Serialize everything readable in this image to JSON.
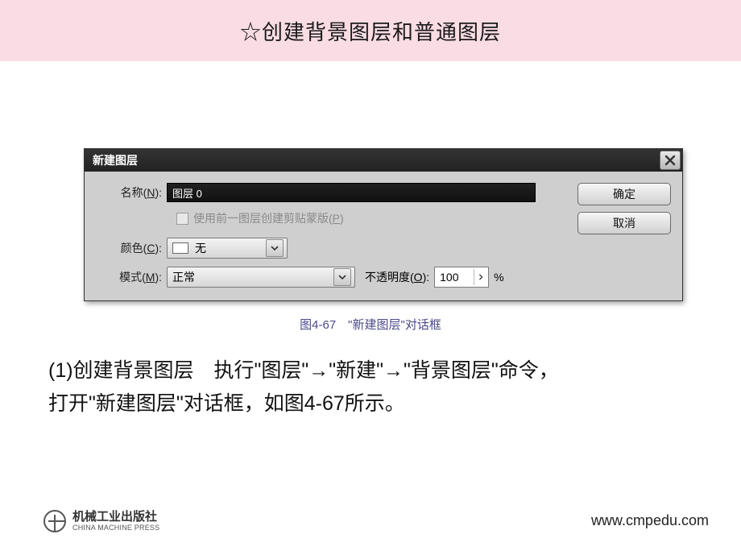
{
  "header": {
    "title": "☆创建背景图层和普通图层"
  },
  "dialog": {
    "title": "新建图层",
    "name_label_pre": "名称(",
    "name_hotkey": "N",
    "name_label_post": "):",
    "name_value": "图层 0",
    "clip_checkbox_label_pre": "使用前一图层创建剪贴蒙版(",
    "clip_hotkey": "P",
    "clip_checkbox_label_post": ")",
    "color_label_pre": "颜色(",
    "color_hotkey": "C",
    "color_label_post": "):",
    "color_value": "无",
    "mode_label_pre": "模式(",
    "mode_hotkey": "M",
    "mode_label_post": "):",
    "mode_value": "正常",
    "opacity_label_pre": "不透明度(",
    "opacity_hotkey": "O",
    "opacity_label_post": "):",
    "opacity_value": "100",
    "opacity_unit": "%",
    "ok_label": "确定",
    "cancel_label": "取消"
  },
  "caption": "图4-67　\"新建图层\"对话框",
  "body": {
    "line1": "(1)创建背景图层　执行\"图层\"→\"新建\"→\"背景图层\"命令，",
    "line2": "打开\"新建图层\"对话框，如图4-67所示。"
  },
  "footer": {
    "publisher_cn": "机械工业出版社",
    "publisher_en": "CHINA MACHINE PRESS",
    "url": "www.cmpedu.com"
  }
}
